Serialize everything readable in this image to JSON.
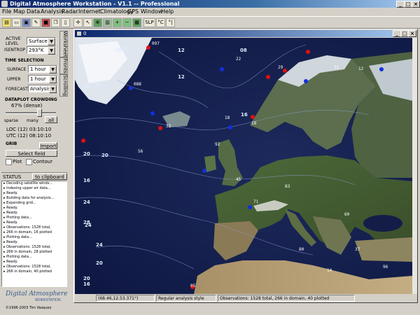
{
  "window": {
    "title": "Digital Atmosphere  Workstation - V1.1 -- Professional"
  },
  "menu": [
    "File",
    "Map",
    "Data",
    "Analysis",
    "Radar",
    "Internet",
    "Climatology",
    "GPS",
    "Window",
    "Help"
  ],
  "toolbar": {
    "slp_label": "SLP",
    "tc_label": "°C",
    "tf_label": "°|"
  },
  "left": {
    "active_level_label": "ACTIVE LEVEL",
    "active_level_value": "Surface",
    "isentrop_label": "ISENTROP",
    "isentrop_value": "293°K",
    "time_selection_label": "TIME SELECTION",
    "surface_label": "SURFACE",
    "surface_value": "1 hour",
    "upper_label": "UPPER",
    "upper_value": "1 hour",
    "forecast_label": "FORECAST",
    "forecast_value": "Analysis",
    "crowding_label": "DATAPLOT CROWDING",
    "crowding_value": "67% (dense)",
    "crowding_level": 0.67,
    "crowd_sparse": "sparse",
    "crowd_many": "many",
    "crowd_all": "all",
    "loc_time": "LOC (12) 03:10:10",
    "utc_time": "UTC (12) 08:10:10",
    "grib_label": "GRIB",
    "import_button": "Import",
    "select_field_button": "Select field",
    "plot_label": "Plot",
    "contour_label": "Contour",
    "status_label": "STATUS",
    "clipboard_button": "to clipboard",
    "tab_worksheet": "Worksheet",
    "tab_fronts": "Fronts",
    "tab_scrolling": "Scrolling",
    "status_lines": [
      "Decoding satellite winds...",
      "Indexing upper air data...",
      "Ready.",
      "Building data for analysis...",
      "Expanding grid...",
      "Ready.",
      "Ready.",
      "Plotting data...",
      "Ready.",
      "Observations: 1528 total,",
      "266 in domain, 16 plotted",
      "Plotting data...",
      "Ready.",
      "Observations: 1528 total,",
      "266 in domain, 28 plotted",
      "Plotting data...",
      "Ready.",
      "Observations: 1528 total,",
      "266 in domain, 40 plotted"
    ],
    "logo_text": "Digital Atmosphere",
    "logo_sub": "WORKSTATION",
    "copyright": "©1996-2003 Tim Vasquez"
  },
  "map": {
    "window_title": "0",
    "lat_labels": [
      {
        "text": "12"
      },
      {
        "text": "12"
      },
      {
        "text": "12"
      },
      {
        "text": "08"
      },
      {
        "text": "16"
      },
      {
        "text": "16"
      },
      {
        "text": "16"
      },
      {
        "text": "20"
      },
      {
        "text": "24"
      },
      {
        "text": "28"
      },
      {
        "text": "24"
      },
      {
        "text": "20"
      },
      {
        "text": "16"
      },
      {
        "text": "16"
      },
      {
        "text": "20"
      },
      {
        "text": "24"
      },
      {
        "text": "16"
      },
      {
        "text": "20"
      }
    ],
    "station_labels": [
      "097",
      "088",
      "22",
      "29",
      "11",
      "12",
      "18",
      "19",
      "32",
      "56",
      "92",
      "45",
      "71",
      "83",
      "60",
      "05",
      "14",
      "96",
      "37",
      "80"
    ]
  },
  "status_bar": {
    "coords": "(68.46,12.53.371°)",
    "style": "Regular analysis style",
    "obs": "Observations: 1528 total, 266 in domain, 40 plotted"
  }
}
